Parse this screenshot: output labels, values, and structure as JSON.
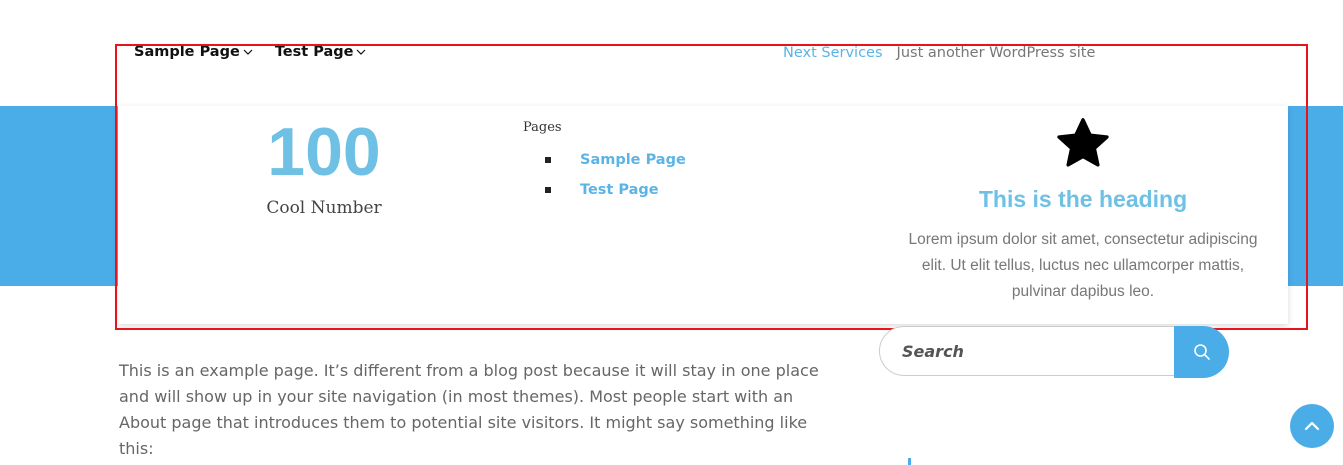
{
  "nav": {
    "items": [
      {
        "label": "Sample Page"
      },
      {
        "label": "Test Page"
      }
    ]
  },
  "header": {
    "site_link": "Next Services",
    "tagline": "Just another WordPress site"
  },
  "mega_menu": {
    "counter": {
      "number": "100",
      "label": "Cool Number"
    },
    "pages_widget": {
      "title": "Pages",
      "links": [
        {
          "label": "Sample Page"
        },
        {
          "label": "Test Page"
        }
      ]
    },
    "icon_box": {
      "icon": "star-icon",
      "heading": "This is the heading",
      "text": "Lorem ipsum dolor sit amet, consectetur adipiscing elit. Ut elit tellus, luctus nec ullamcorper mattis, pulvinar dapibus leo."
    }
  },
  "content": {
    "paragraph": "This is an example page. It’s different from a blog post because it will stay in one place and will show up in your site navigation (in most themes). Most people start with an About page that introduces them to potential site visitors. It might say something like this:"
  },
  "search": {
    "placeholder": "Search"
  },
  "colors": {
    "accent": "#4aade8",
    "link": "#5bb4e5",
    "counter": "#6ec1e4",
    "highlight_border": "#e8141c"
  }
}
